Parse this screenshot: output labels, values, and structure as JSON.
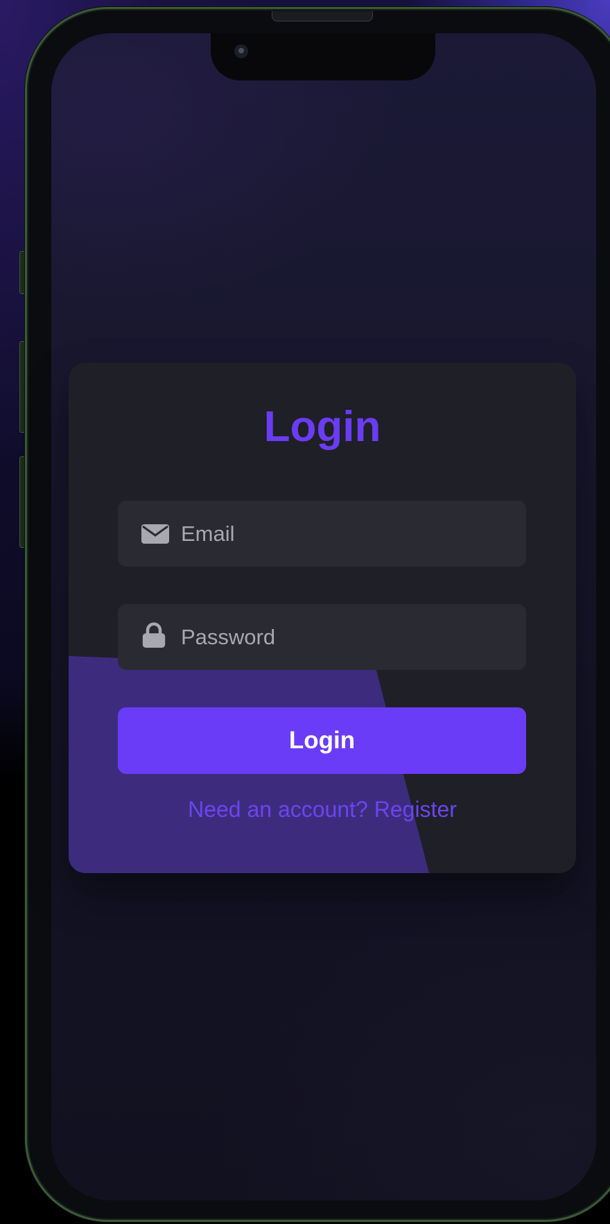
{
  "login_card": {
    "title": "Login",
    "email": {
      "placeholder": "Email",
      "icon": "envelope-icon"
    },
    "password": {
      "placeholder": "Password",
      "icon": "lock-icon"
    },
    "submit_label": "Login",
    "register_link": "Need an account? Register"
  },
  "colors": {
    "accent": "#6a3cf7",
    "card_background": "#1f1f27",
    "field_background": "#2a2a33",
    "screen_background": "#18172d"
  }
}
